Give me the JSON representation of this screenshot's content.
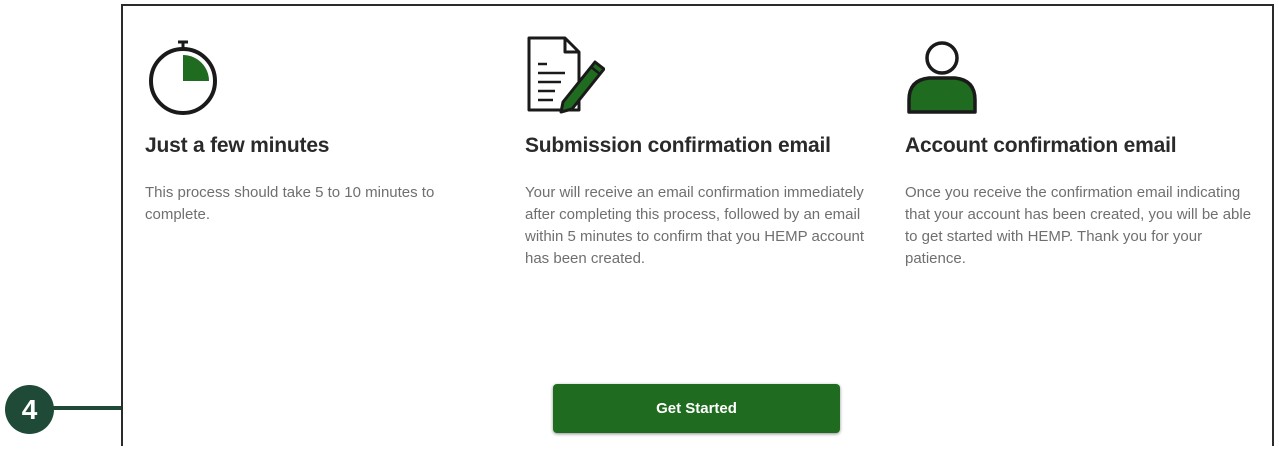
{
  "colors": {
    "brand_green": "#1f6b1f",
    "callout_green": "#1f4a37",
    "heading_text": "#2a2a2a",
    "body_text": "#6f6f6f"
  },
  "cards": [
    {
      "icon": "stopwatch-icon",
      "title": "Just a few minutes",
      "text": "This process should take 5 to 10 minutes to complete."
    },
    {
      "icon": "document-pencil-icon",
      "title": "Submission confirmation email",
      "text": "Your will receive an email confirmation immediately after completing this process, followed by an email within 5 minutes to confirm that you HEMP account has been created."
    },
    {
      "icon": "user-icon",
      "title": "Account confirmation email",
      "text": "Once you receive the confirmation email indicating that your account has been created, you will be able to get started with HEMP. Thank you for your patience."
    }
  ],
  "actions": {
    "get_started_label": "Get Started"
  },
  "annotation": {
    "step_number": "4",
    "arrow_icon": "arrow-right-icon"
  }
}
